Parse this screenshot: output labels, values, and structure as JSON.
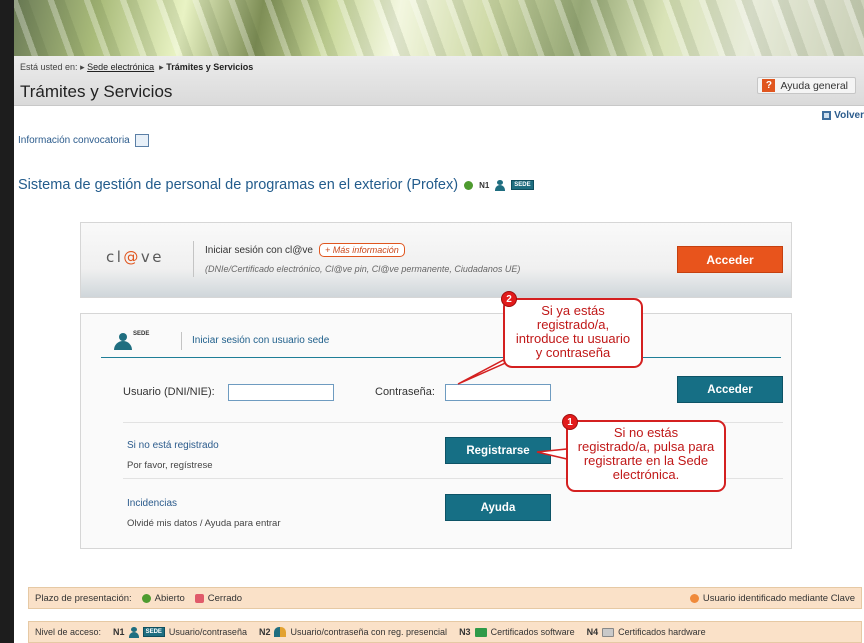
{
  "breadcrumb": {
    "prefix": "Está usted en:",
    "item1": "Sede electrónica",
    "item2": "Trámites y Servicios"
  },
  "page": {
    "title": "Trámites y Servicios",
    "help_label": "Ayuda general",
    "back_label": "Volver",
    "info_link": "Información convocatoria",
    "system_title": "Sistema de gestión de personal de programas en el exterior (Profex)",
    "level_tag": "N1",
    "sede_tag": "SEDE"
  },
  "clave": {
    "logo_left": "cl",
    "logo_at": "@",
    "logo_right": "ve",
    "title": "Iniciar sesión con cl@ve",
    "more_info": "+ Más información",
    "subtitle": "(DNIe/Certificado electrónico, Cl@ve pin, Cl@ve permanente, Ciudadanos UE)",
    "button": "Acceder"
  },
  "sede_login": {
    "logo_tag": "SEDE",
    "title": "Iniciar sesión con usuario sede",
    "user_label": "Usuario (DNI/NIE):",
    "user_value": "",
    "password_label": "Contraseña:",
    "password_value": "",
    "button": "Acceder",
    "not_registered_title": "Si no está registrado",
    "not_registered_text": "Por favor, regístrese",
    "register_button": "Registrarse",
    "issues_title": "Incidencias",
    "issues_text": "Olvidé mis datos / Ayuda para entrar",
    "help_button": "Ayuda"
  },
  "callouts": {
    "one_number": "1",
    "one_text": "Si no estás registrado/a, pulsa para registrarte en la Sede electrónica.",
    "two_number": "2",
    "two_text": "Si ya estás registrado/a, introduce tu usuario y contraseña"
  },
  "legend": {
    "period_label": "Plazo de presentación:",
    "open": "Abierto",
    "closed": "Cerrado",
    "clave_user": "Usuario identificado mediante Clave",
    "access_label": "Nivel de acceso:",
    "n1": "N1",
    "n1_tag": "SEDE",
    "n1_text": "Usuario/contraseña",
    "n2": "N2",
    "n2_text": "Usuario/contraseña con reg. presencial",
    "n3": "N3",
    "n3_text": "Certificados software",
    "n4": "N4",
    "n4_text": "Certificados hardware"
  }
}
